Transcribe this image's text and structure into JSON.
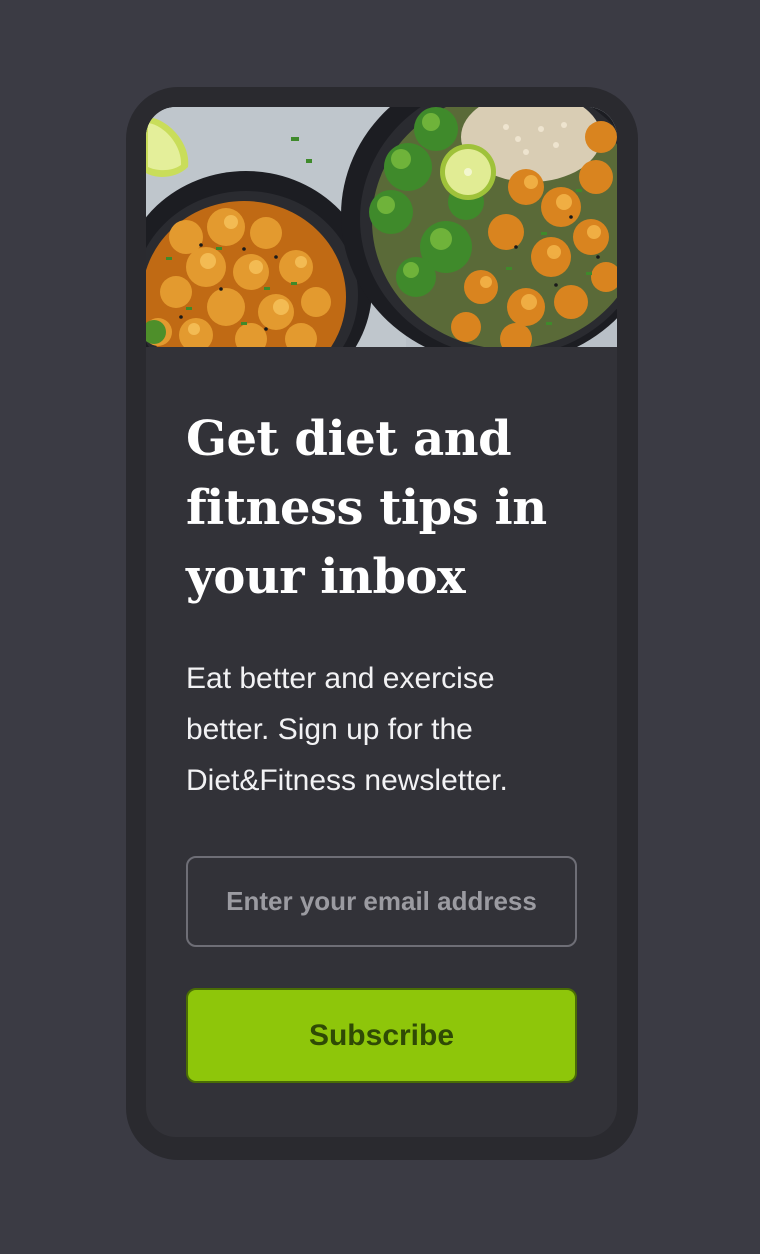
{
  "newsletter": {
    "title": "Get diet and fitness tips in your inbox",
    "description": "Eat better and exercise better. Sign up for the Diet&Fitness newsletter.",
    "email_placeholder": "Enter your email address",
    "email_value": "",
    "subscribe_label": "Subscribe"
  },
  "hero": {
    "subject": "bowls of glazed chicken with broccoli, quinoa and lime"
  },
  "colors": {
    "page_background": "#3b3b44",
    "phone_frame": "#2a2a2f",
    "card_background": "#323238",
    "accent": "#8ec60a",
    "accent_text": "#2f4a05",
    "input_border": "#6e6e76"
  }
}
